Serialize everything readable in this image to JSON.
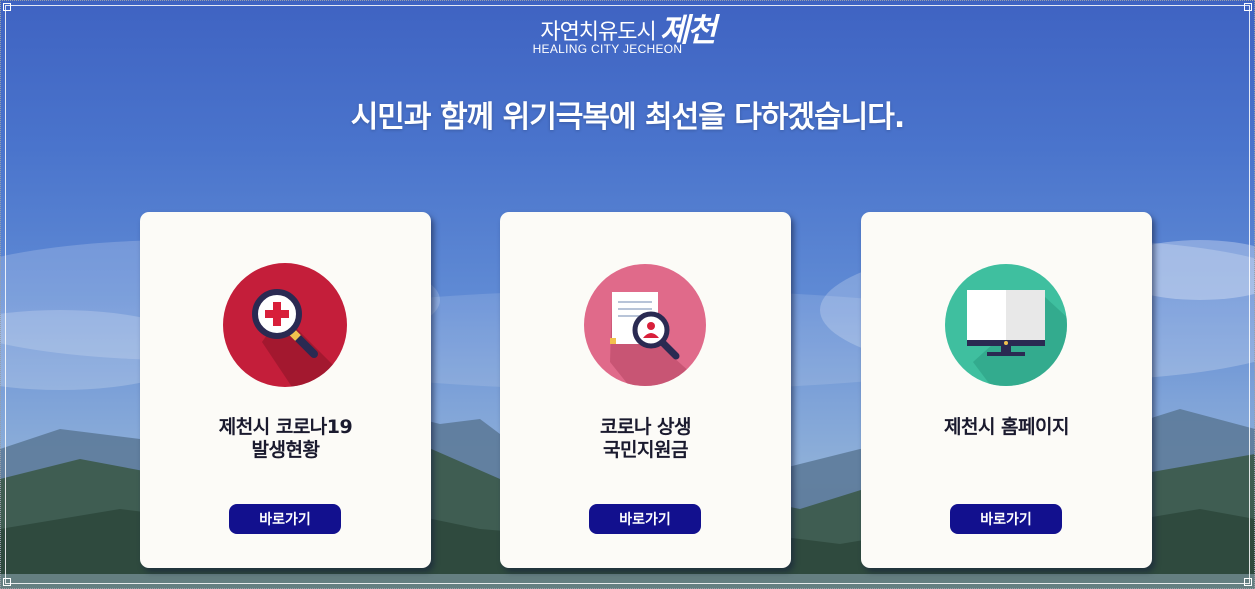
{
  "logo": {
    "main": "자연치유도시",
    "script": "제천",
    "sub": "HEALING CITY JECHEON"
  },
  "headline": "시민과 함께 위기극복에 최선을 다하겠습니다.",
  "cards": [
    {
      "title_line1": "제천시 코로나19",
      "title_line2": "발생현황",
      "button": "바로가기",
      "icon": "magnifier-medical-cross-icon",
      "icon_color": "#c41e3a"
    },
    {
      "title_line1": "코로나 상생",
      "title_line2": "국민지원금",
      "button": "바로가기",
      "icon": "document-magnifier-person-icon",
      "icon_color": "#e06a8a"
    },
    {
      "title_line1": "제천시 홈페이지",
      "title_line2": "",
      "button": "바로가기",
      "icon": "computer-monitor-icon",
      "icon_color": "#3fbf9f"
    }
  ],
  "colors": {
    "button_bg": "#12108e",
    "card_bg": "#fcfbf7",
    "sky_top": "#3f63c2"
  }
}
